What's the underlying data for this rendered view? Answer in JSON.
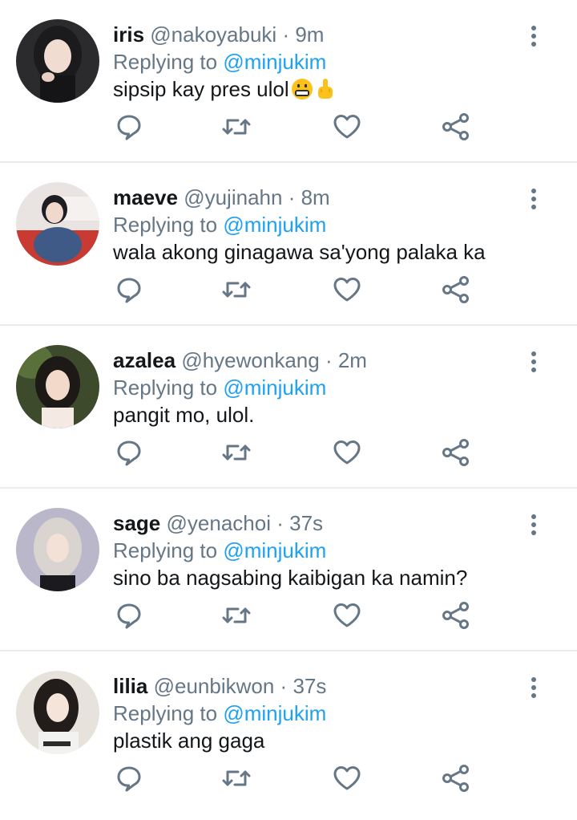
{
  "colors": {
    "name": "#14171a",
    "meta": "#657786",
    "mention": "#1da1f2",
    "icon": "#657786",
    "divider": "#e6ecf0"
  },
  "icons": {
    "more": "more-vertical-icon",
    "reply": "reply-bubble-icon",
    "retweet": "retweet-icon",
    "like": "heart-icon",
    "share": "share-icon"
  },
  "tweets": [
    {
      "name": "iris",
      "handle": "@nakoyabuki",
      "time": "9m",
      "replying_prefix": "Replying to",
      "replying_to": "@minjukim",
      "text": "sipsip kay pres ulol",
      "emojis": [
        "grimacing-cursing-face-emoji",
        "middle-finger-emoji"
      ]
    },
    {
      "name": "maeve",
      "handle": "@yujinahn",
      "time": "8m",
      "replying_prefix": "Replying to",
      "replying_to": "@minjukim",
      "text": "wala akong ginagawa sa'yong palaka ka"
    },
    {
      "name": "azalea",
      "handle": "@hyewonkang",
      "time": "2m",
      "replying_prefix": "Replying to",
      "replying_to": "@minjukim",
      "text": "pangit mo, ulol."
    },
    {
      "name": "sage",
      "handle": "@yenachoi",
      "time": "37s",
      "replying_prefix": "Replying to",
      "replying_to": "@minjukim",
      "text": "sino ba nagsabing kaibigan ka namin?"
    },
    {
      "name": "lilia",
      "handle": "@eunbikwon",
      "time": "37s",
      "replying_prefix": "Replying to",
      "replying_to": "@minjukim",
      "text": "plastik ang gaga"
    }
  ]
}
